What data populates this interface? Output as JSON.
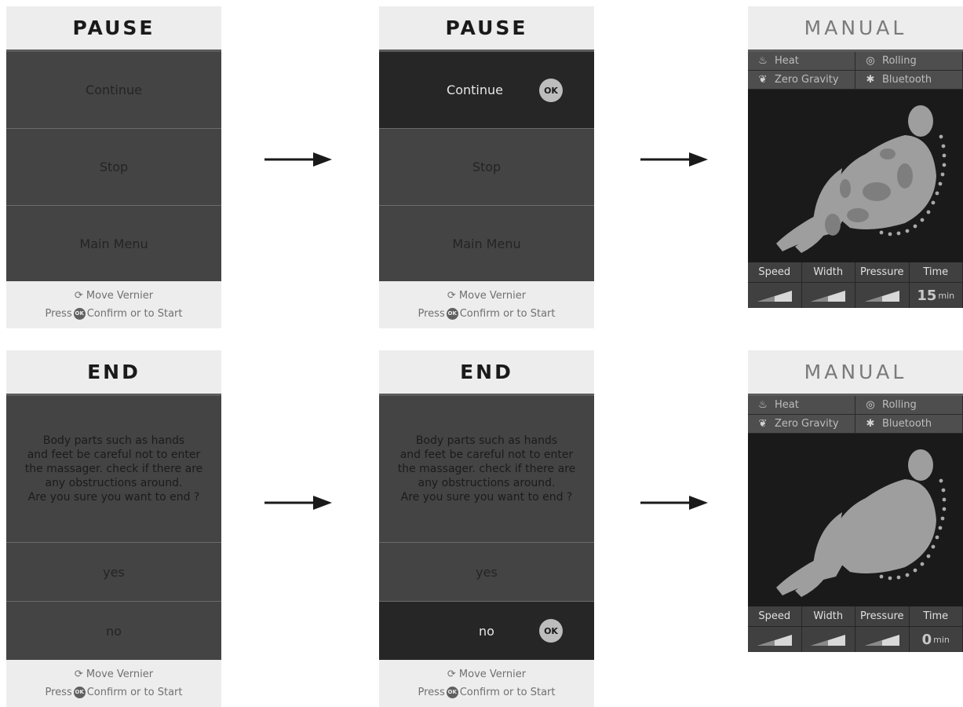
{
  "pause": {
    "title": "PAUSE",
    "items": [
      "Continue",
      "Stop",
      "Main Menu"
    ],
    "ok_label": "OK"
  },
  "end": {
    "title": "END",
    "message": [
      "Body parts such as hands",
      "and feet be careful not to enter",
      "the massager. check if there are",
      "any obstructions around.",
      "Are you sure you want to end ?"
    ],
    "yes": "yes",
    "no": "no",
    "ok_label": "OK"
  },
  "footer": {
    "move_glyph": "⟳",
    "move_text": "Move Vernier",
    "press_text": "Press",
    "ok_label": "OK",
    "confirm_text": "Confirm or to Start"
  },
  "manual": {
    "title": "MANUAL",
    "options": [
      {
        "label": "Heat",
        "icon": "flame-icon",
        "glyph": "🔥"
      },
      {
        "label": "Rolling",
        "icon": "rolling-icon",
        "glyph": "◎"
      },
      {
        "label": "Zero Gravity",
        "icon": "zero-gravity-icon",
        "glyph": "✦"
      },
      {
        "label": "Bluetooth",
        "icon": "bluetooth-icon",
        "glyph": "✱"
      }
    ],
    "stat_labels": [
      "Speed",
      "Width",
      "Pressure",
      "Time"
    ],
    "time_top": "15",
    "time_bottom": "0",
    "time_unit": "min"
  },
  "arrow_color": "#1a1a1a"
}
